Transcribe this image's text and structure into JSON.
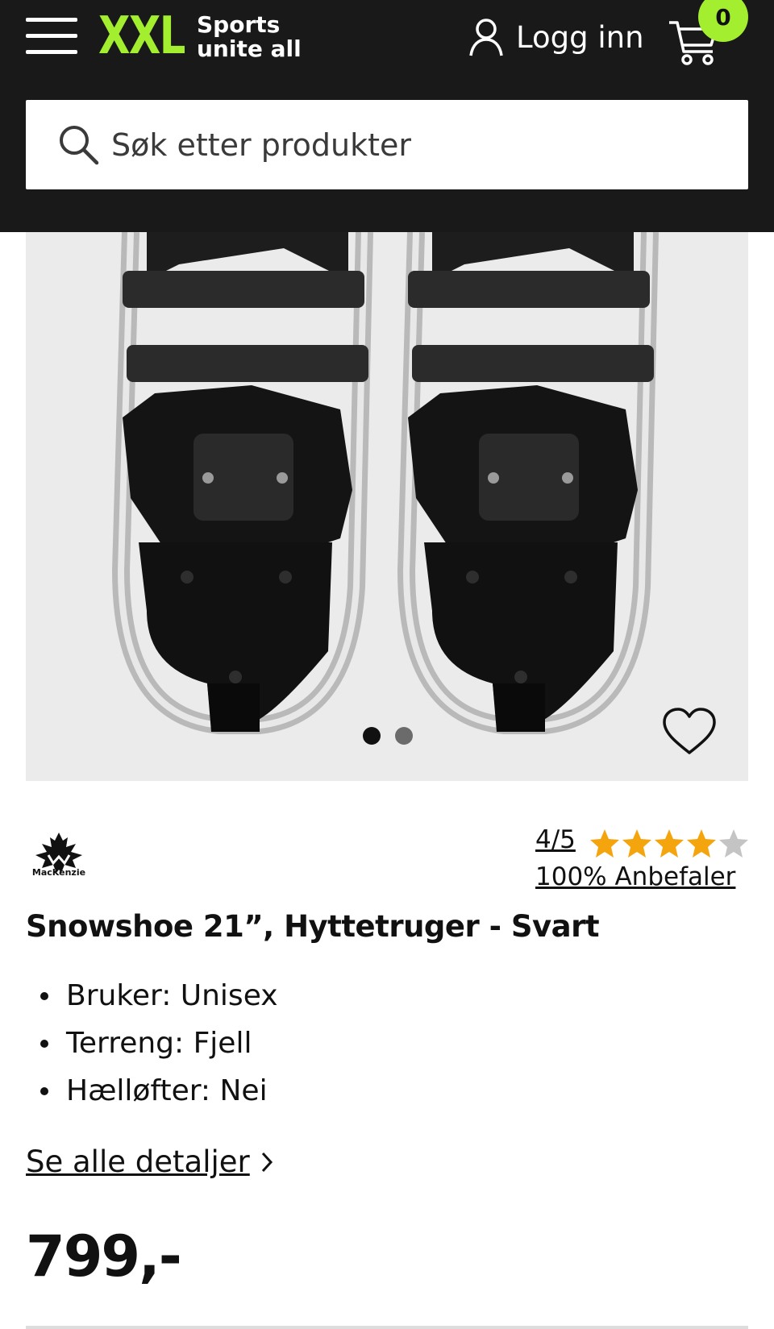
{
  "header": {
    "logo_text": "XXL",
    "logo_tagline_1": "Sports",
    "logo_tagline_2": "unite all",
    "login_label": "Logg inn",
    "cart_count": "0",
    "colors": {
      "background": "#191919",
      "accent": "#a3ee2f"
    }
  },
  "search": {
    "placeholder": "Søk etter produkter"
  },
  "gallery": {
    "image_count": 2,
    "active_index": 0,
    "favorite_icon": "heart-icon"
  },
  "product": {
    "brand": "MacKenzie",
    "rating_text": "4/5",
    "rating_value": 4,
    "rating_max": 5,
    "recommend_text": "100% Anbefaler",
    "title": "Snowshoe 21”, Hyttetruger - Svart",
    "specs": [
      "Bruker: Unisex",
      "Terreng: Fjell",
      "Hælløfter: Nei"
    ],
    "details_link": "Se alle detaljer",
    "price": "799,-",
    "star_color": "#f4a50e"
  }
}
